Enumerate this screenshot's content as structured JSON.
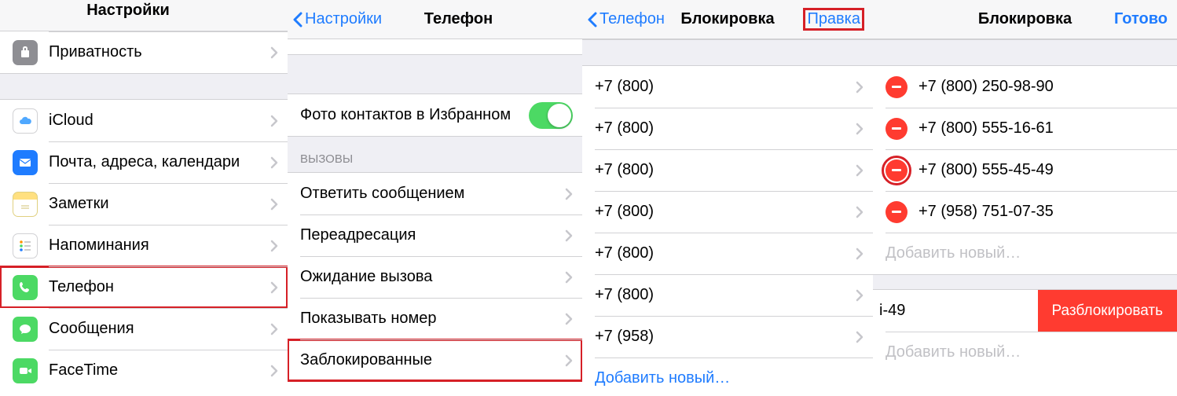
{
  "pane1": {
    "title": "Настройки",
    "items": [
      {
        "label": "Приватность",
        "icon": "privacy",
        "bg": "#8e8e93"
      },
      {
        "label": "iCloud",
        "icon": "cloud",
        "bg": "#ffffff"
      },
      {
        "label": "Почта, адреса, календари",
        "icon": "mail",
        "bg": "#1f7cff"
      },
      {
        "label": "Заметки",
        "icon": "notes",
        "bg": "#ffcc00"
      },
      {
        "label": "Напоминания",
        "icon": "reminders",
        "bg": "#ffffff"
      },
      {
        "label": "Телефон",
        "icon": "phone",
        "bg": "#4cd964"
      },
      {
        "label": "Сообщения",
        "icon": "messages",
        "bg": "#4cd964"
      },
      {
        "label": "FaceTime",
        "icon": "facetime",
        "bg": "#4cd964"
      }
    ]
  },
  "pane2": {
    "back": "Настройки",
    "title": "Телефон",
    "toggle_row": "Фото контактов в Избранном",
    "section": "ВЫЗОВЫ",
    "rows": [
      "Ответить сообщением",
      "Переадресация",
      "Ожидание вызова",
      "Показывать номер",
      "Заблокированные"
    ]
  },
  "pane3": {
    "back": "Телефон",
    "title": "Блокировка",
    "edit": "Правка",
    "numbers": [
      "+7 (800)",
      "+7 (800)",
      "+7 (800)",
      "+7 (800)",
      "+7 (800)",
      "+7 (800)",
      "+7 (958)"
    ],
    "add": "Добавить новый…"
  },
  "pane4": {
    "title": "Блокировка",
    "done": "Готово",
    "numbers": [
      "+7 (800) 250-98-90",
      "+7 (800) 555-16-61",
      "+7 (800) 555-45-49",
      "+7 (958) 751-07-35"
    ],
    "add": "Добавить новый…",
    "partial": "і-49",
    "unblock": "Разблокировать",
    "add2": "Добавить новый…"
  }
}
